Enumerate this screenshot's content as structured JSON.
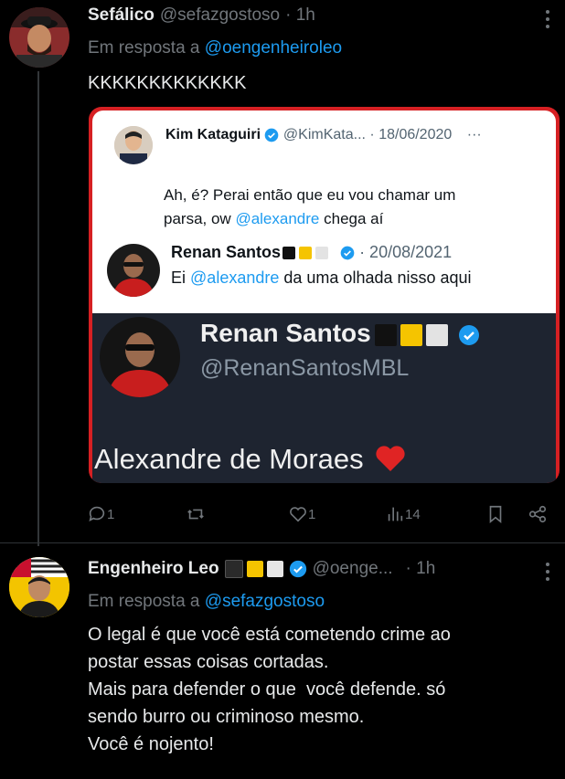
{
  "tweet1": {
    "display_name": "Sefálico",
    "handle": "@sefazgostoso",
    "time": "· 1h",
    "reply_prefix": "Em resposta a",
    "reply_to": "@oengenheiroleo",
    "text": "KKKKKKKKKKKKK",
    "embed": {
      "quoted": {
        "name": "Kim Kataguiri",
        "handle": "@KimKata...",
        "date": "· 18/06/2020",
        "text_before": "Ah, é? Perai então que eu vou chamar um",
        "text_line2_before": "parsa, ow",
        "mention": "@alexandre",
        "text_line2_after": "chega aí"
      },
      "reply": {
        "name": "Renan Santos",
        "date": "· 20/08/2021",
        "text_before": "Ei",
        "mention": "@alexandre",
        "text_after": "da uma olhada nisso aqui"
      },
      "profile": {
        "name": "Renan Santos",
        "handle": "@RenanSantosMBL",
        "caption": "Alexandre de Moraes"
      }
    },
    "actions": {
      "replies": "1",
      "likes": "1",
      "views": "14"
    }
  },
  "tweet2": {
    "display_name": "Engenheiro Leo",
    "handle": "@oenge...",
    "time": "· 1h",
    "reply_prefix": "Em resposta a",
    "reply_to": "@sefazgostoso",
    "lines": [
      "O legal é que você está cometendo crime ao",
      "postar essas coisas cortadas.",
      "Mais para defender o que  você defende. só",
      "sendo burro ou criminoso mesmo.",
      "Você é nojento!"
    ]
  },
  "colors": {
    "background": "#000000",
    "link": "#1d9bf0",
    "muted": "#71767b",
    "verified": "#1d9bf0",
    "embed_border": "#d62023"
  },
  "icons": [
    "more-icon",
    "verified-icon",
    "reply-icon",
    "retweet-icon",
    "like-icon",
    "views-icon",
    "bookmark-icon",
    "share-icon",
    "heart-emoji-icon"
  ]
}
